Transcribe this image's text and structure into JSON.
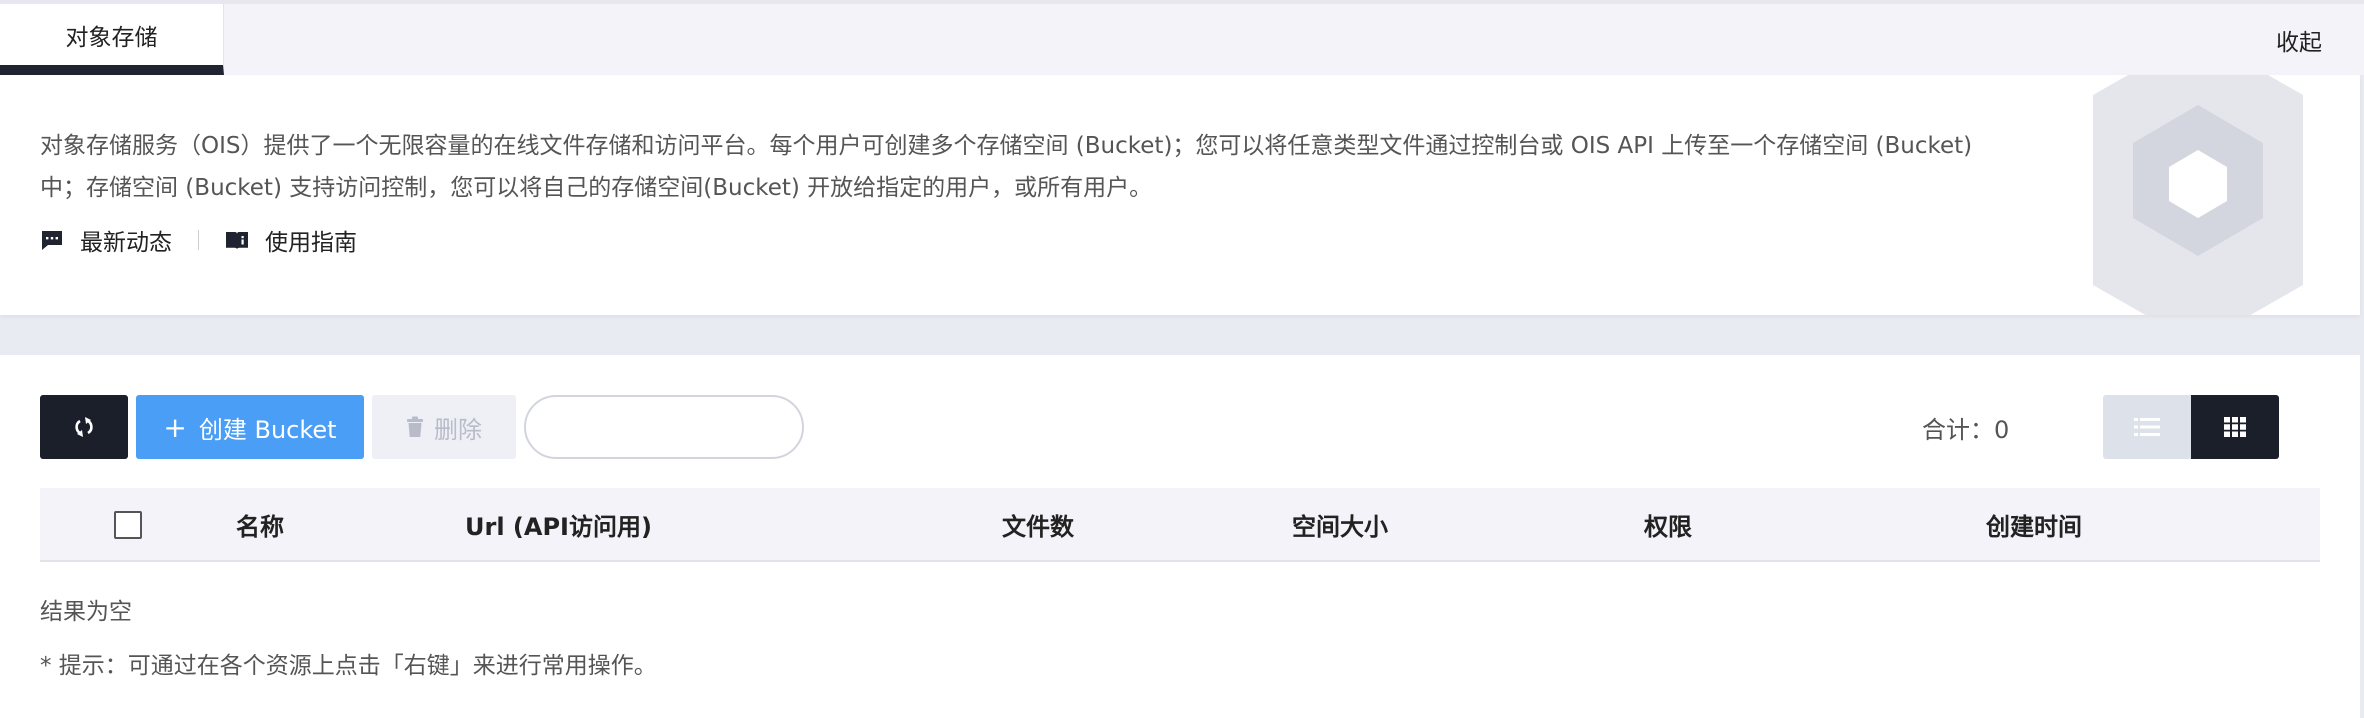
{
  "tabs": {
    "active_label": "对象存储",
    "collapse_label": "收起"
  },
  "intro": {
    "description": "对象存储服务（OIS）提供了一个无限容量的在线文件存储和访问平台。每个用户可创建多个存储空间 (Bucket)；您可以将任意类型文件通过控制台或 OIS API 上传至一个存储空间 (Bucket) 中；存储空间 (Bucket) 支持访问控制，您可以将自己的存储空间(Bucket) 开放给指定的用户，或所有用户。",
    "links": [
      {
        "label": "最新动态",
        "icon": "message-icon"
      },
      {
        "label": "使用指南",
        "icon": "book-icon"
      }
    ]
  },
  "toolbar": {
    "refresh_icon": "refresh-icon",
    "create_label": "创建 Bucket",
    "create_plus": "+",
    "delete_label": "删除",
    "search_placeholder": "",
    "total_label": "合计：0"
  },
  "table": {
    "columns": [
      "名称",
      "Url (API访问用)",
      "文件数",
      "空间大小",
      "权限",
      "创建时间"
    ],
    "rows": [],
    "empty_text": "结果为空"
  },
  "tip": "* 提示：可通过在各个资源上点击「右键」来进行常用操作。",
  "colors": {
    "primary": "#4a9ef5",
    "dark": "#1b1f2a",
    "page_bg": "#e9ebf3"
  }
}
